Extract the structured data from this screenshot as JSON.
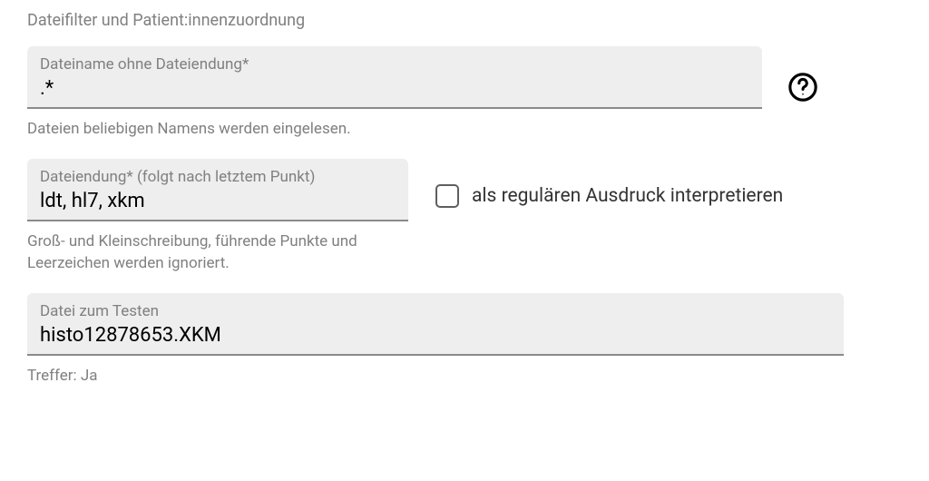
{
  "section": {
    "title": "Dateifilter und Patient:innenzuordnung"
  },
  "filename": {
    "label": "Dateiname ohne Dateiendung*",
    "value": ".*",
    "helper": "Dateien beliebigen Namens werden eingelesen."
  },
  "extension": {
    "label": "Dateiendung* (folgt nach letztem Punkt)",
    "value": "ldt, hl7, xkm",
    "helper": "Groß- und Kleinschreibung, führende Punkte und Leerzeichen werden ignoriert."
  },
  "regex_checkbox": {
    "label": "als regulären Ausdruck interpretieren",
    "checked": false
  },
  "testfile": {
    "label": "Datei zum Testen",
    "value": "histo12878653.XKM",
    "result": "Treffer: Ja"
  }
}
